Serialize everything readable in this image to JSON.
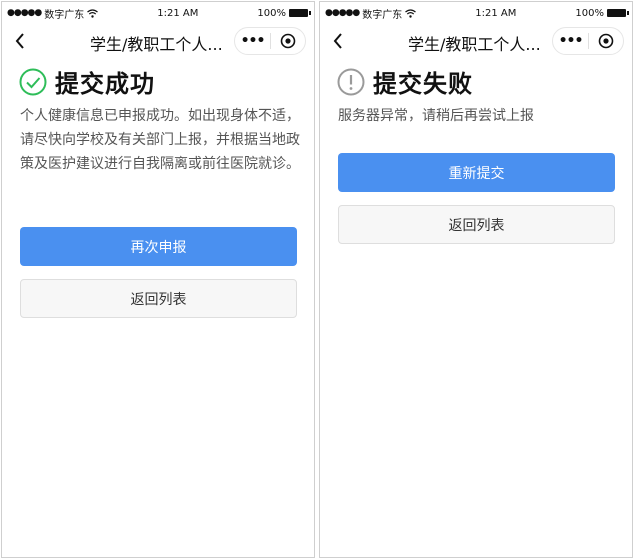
{
  "status_bar": {
    "carrier": "数字广东",
    "time": "1:21 AM",
    "battery": "100%"
  },
  "nav": {
    "title": "学生/教职工个人...",
    "more_icon": "ellipsis-icon",
    "close_icon": "target-circle-icon"
  },
  "success_screen": {
    "icon": "check-circle-icon",
    "icon_color": "#2ebd59",
    "title": "提交成功",
    "message": "个人健康信息已申报成功。如出现身体不适，请尽快向学校及有关部门上报，并根据当地政策及医护建议进行自我隔离或前往医院就诊。",
    "primary_button": "再次申报",
    "secondary_button": "返回列表"
  },
  "failure_screen": {
    "icon": "exclamation-circle-icon",
    "icon_color": "#9a9a9a",
    "title": "提交失败",
    "message": "服务器异常，请稍后再尝试上报",
    "primary_button": "重新提交",
    "secondary_button": "返回列表"
  },
  "colors": {
    "primary": "#4a90f0",
    "secondary_bg": "#f7f7f7"
  }
}
